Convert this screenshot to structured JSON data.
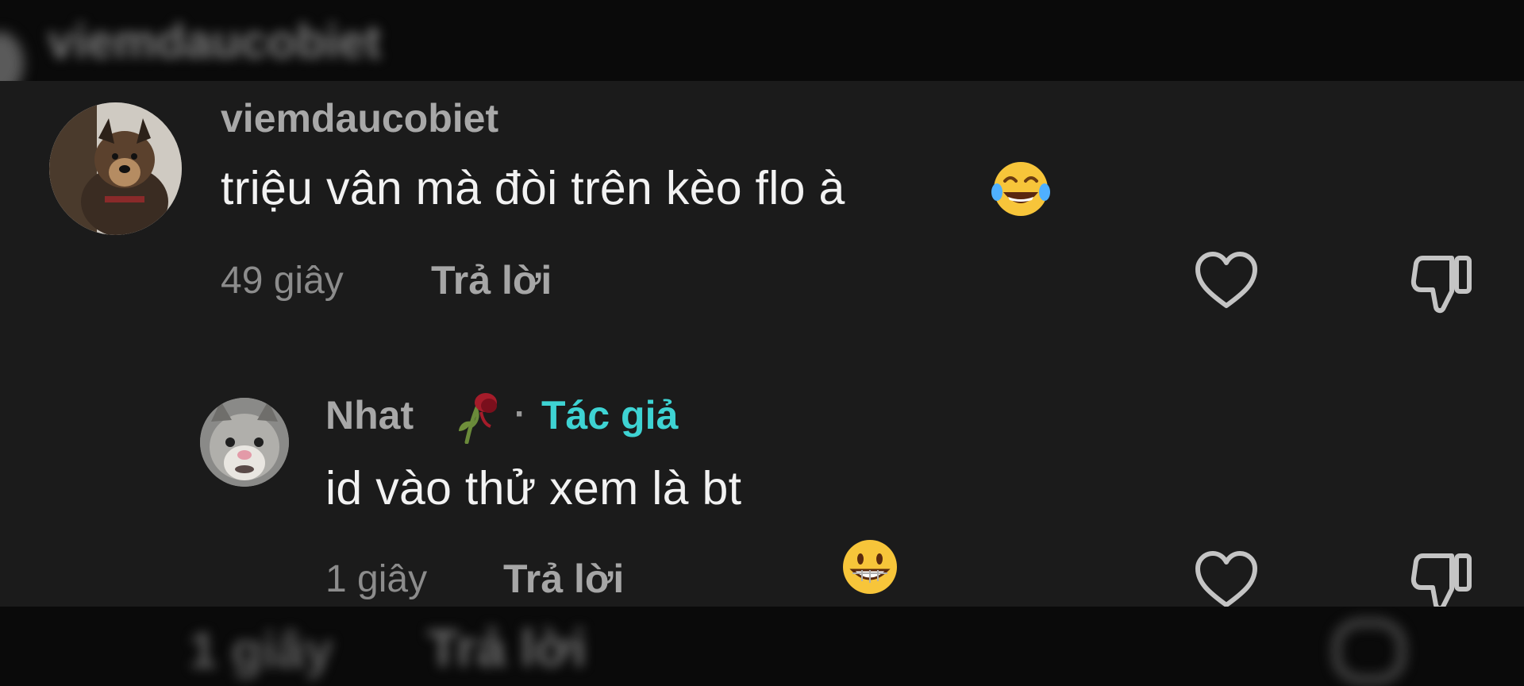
{
  "blurred_top": {
    "username": "viemdaucobiet"
  },
  "comments": [
    {
      "username": "viemdaucobiet",
      "text": "triệu vân mà đòi trên kèo flo à",
      "emoji": "tears-of-joy-emoji",
      "time": "49 giây",
      "reply_label": "Trả lời"
    },
    {
      "username": "Nhat",
      "username_emoji": "wilted-rose-emoji",
      "separator": "·",
      "author_badge": "Tác giả",
      "text": "id vào thử xem là bt",
      "emoji": "grinning-face-emoji",
      "time": "1 giây",
      "reply_label": "Trả lời"
    }
  ],
  "blurred_bottom": {
    "time": "1 giây",
    "reply_label": "Trả lời"
  },
  "colors": {
    "background": "#1b1b1b",
    "author_badge": "#3ed3d3",
    "username": "#a8a8a8",
    "comment_text": "#f2f2f2"
  }
}
